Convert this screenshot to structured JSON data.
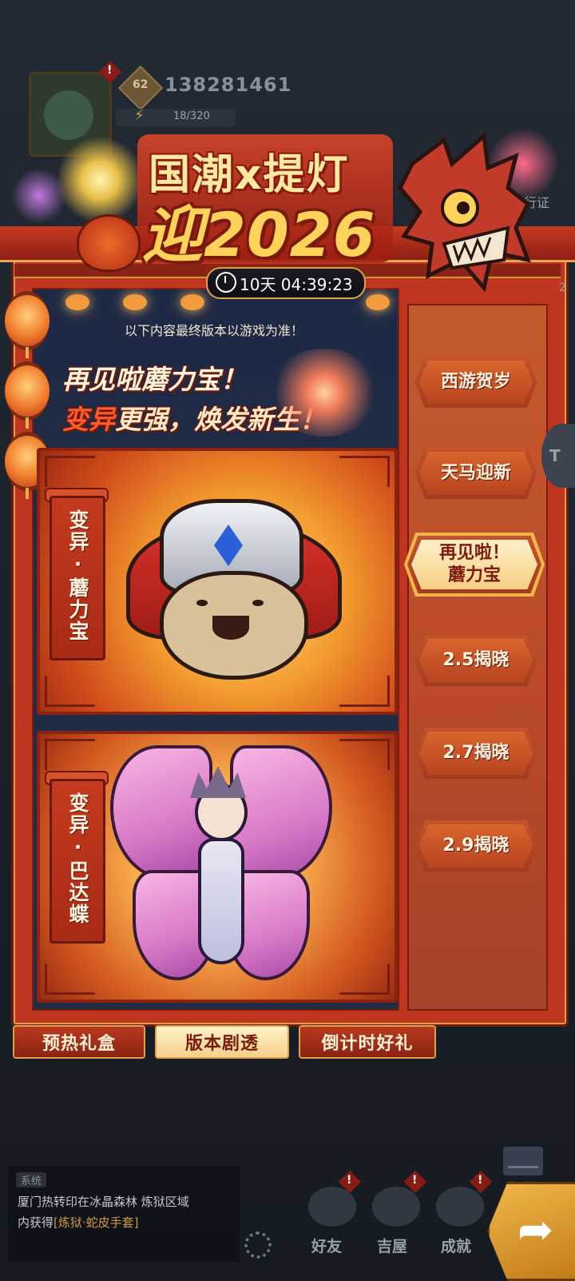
{
  "hud": {
    "level_badge": "62",
    "player_id": "138281461",
    "energy": "18/320",
    "pass_label": "通行证",
    "alert_mark": "!",
    "edge_number": "2",
    "side_button_label": "T"
  },
  "event": {
    "title_line1": "国潮x提灯",
    "title_line2": "迎2026",
    "countdown": "10天 04:39:23",
    "notice": "以下内容最终版本以游戏为准！",
    "headline1": "再见啦蘑力宝！",
    "headline2_highlight": "变异",
    "headline2_rest": "更强，焕发新生！"
  },
  "cards": [
    {
      "label": "变异·蘑力宝"
    },
    {
      "label": "变异·巴达蝶"
    }
  ],
  "side_tabs": [
    {
      "label": "西游贺岁",
      "active": false
    },
    {
      "label": "天马迎新",
      "active": false
    },
    {
      "label": "再见啦！\n蘑力宝",
      "active": true
    },
    {
      "label": "2.5揭晓",
      "active": false
    },
    {
      "label": "2.7揭晓",
      "active": false
    },
    {
      "label": "2.9揭晓",
      "active": false
    }
  ],
  "bottom_tabs": [
    {
      "label": "预热礼盒",
      "active": false
    },
    {
      "label": "版本剧透",
      "active": true
    },
    {
      "label": "倒计时好礼",
      "active": false
    }
  ],
  "chat": {
    "tag": "系统",
    "line1": "厦门热转印在冰晶森林 炼狱区域",
    "line2_prefix": "内获得",
    "line2_item": "[炼狱·蛇皮手套]"
  },
  "nav": {
    "mail": "邮件",
    "friends": "好友",
    "house": "吉屋",
    "achievements": "成就"
  },
  "colors": {
    "panel_red": "#c0351f",
    "gold": "#e0a04a",
    "active_tab_bg": "#f5d08a"
  }
}
